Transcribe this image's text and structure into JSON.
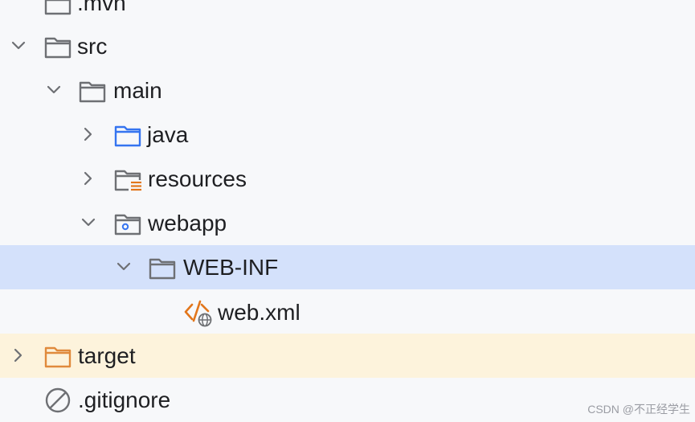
{
  "tree": {
    "items": [
      {
        "label": ".mvn",
        "icon": "folder-icon",
        "expanded": false
      },
      {
        "label": "src",
        "icon": "folder-icon",
        "expanded": true
      },
      {
        "label": "main",
        "icon": "folder-icon",
        "expanded": true
      },
      {
        "label": "java",
        "icon": "source-folder-icon",
        "expanded": false
      },
      {
        "label": "resources",
        "icon": "resources-folder-icon",
        "expanded": false
      },
      {
        "label": "webapp",
        "icon": "web-folder-icon",
        "expanded": true
      },
      {
        "label": "WEB-INF",
        "icon": "folder-icon",
        "expanded": true,
        "selected": true
      },
      {
        "label": "web.xml",
        "icon": "xml-file-icon"
      },
      {
        "label": "target",
        "icon": "excluded-folder-icon",
        "expanded": false,
        "excluded": true
      },
      {
        "label": ".gitignore",
        "icon": "ignored-file-icon"
      }
    ]
  },
  "colors": {
    "selected_row": "#d4e1fb",
    "excluded_row": "#fdf3dc",
    "folder_stroke": "#6e7074",
    "source_folder": "#3574f0",
    "resources_accent": "#e2761b",
    "excluded_folder": "#e08a3c",
    "xml_orange": "#e2761b"
  },
  "watermark": "CSDN @不正经学生"
}
